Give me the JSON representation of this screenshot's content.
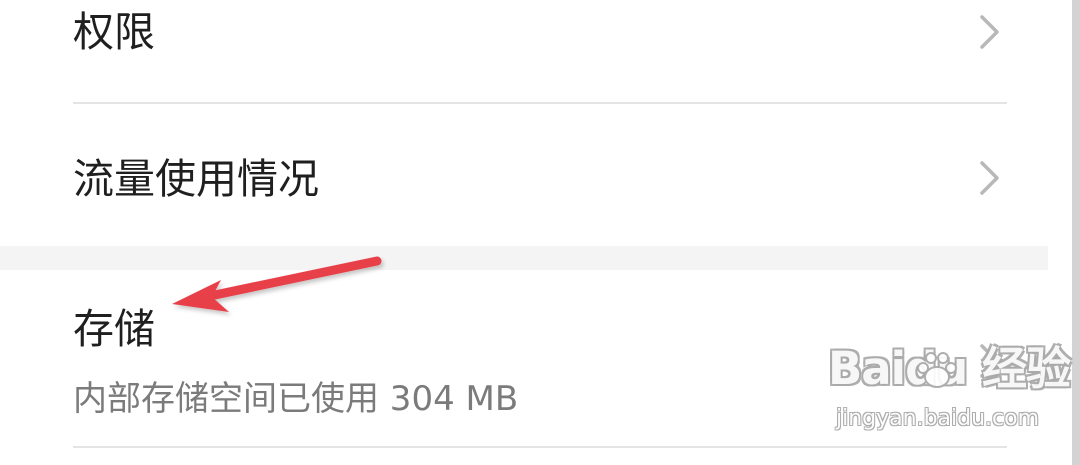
{
  "settings": {
    "items": [
      {
        "label": "权限",
        "icon": "chevron-right-icon"
      },
      {
        "label": "流量使用情况",
        "icon": "chevron-right-icon"
      },
      {
        "label": "存储",
        "description": "内部存储空间已使用 304 MB",
        "icon": "chevron-right-icon"
      }
    ]
  },
  "annotation": {
    "arrow": "red-arrow-icon",
    "arrow_color": "#e8404a"
  },
  "watermark": {
    "text": "Baidu 经验",
    "url": "jingyan.baidu.com",
    "icon": "paw-icon"
  },
  "colors": {
    "text_primary": "#1f1f1f",
    "text_secondary": "#7b7b7b",
    "divider": "#e4e4e4",
    "section_gap": "#f4f4f4",
    "chevron": "#b8b8b8"
  }
}
